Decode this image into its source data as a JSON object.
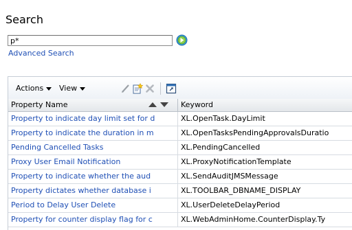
{
  "search": {
    "title": "Search",
    "query": "p*",
    "go_icon": "go-arrow-icon",
    "advanced_label": "Advanced Search"
  },
  "toolbar": {
    "actions_label": "Actions",
    "view_label": "View",
    "icons": [
      "edit-pencil-icon",
      "create-new-icon",
      "delete-x-icon",
      "detach-icon"
    ]
  },
  "table": {
    "columns": [
      "Property Name",
      "Keyword"
    ],
    "rows": [
      {
        "name": "Property to indicate day limit set for d",
        "keyword": "XL.OpenTask.DayLimit"
      },
      {
        "name": "Property to indicate the duration in m",
        "keyword": "XL.OpenTasksPendingApprovalsDuratio"
      },
      {
        "name": "Pending Cancelled Tasks",
        "keyword": "XL.PendingCancelled"
      },
      {
        "name": "Proxy User Email Notification",
        "keyword": "XL.ProxyNotificationTemplate"
      },
      {
        "name": "Property to indicate whether the aud",
        "keyword": "XL.SendAuditJMSMessage"
      },
      {
        "name": "Property dictates whether database i",
        "keyword": "XL.TOOLBAR_DBNAME_DISPLAY"
      },
      {
        "name": "Period to Delay User Delete",
        "keyword": "XL.UserDeleteDelayPeriod"
      },
      {
        "name": "Property for counter display flag for c",
        "keyword": "XL.WebAdminHome.CounterDisplay.Ty"
      }
    ]
  },
  "colors": {
    "link": "#1f4fb5",
    "go_button": "#2a8fd6"
  }
}
